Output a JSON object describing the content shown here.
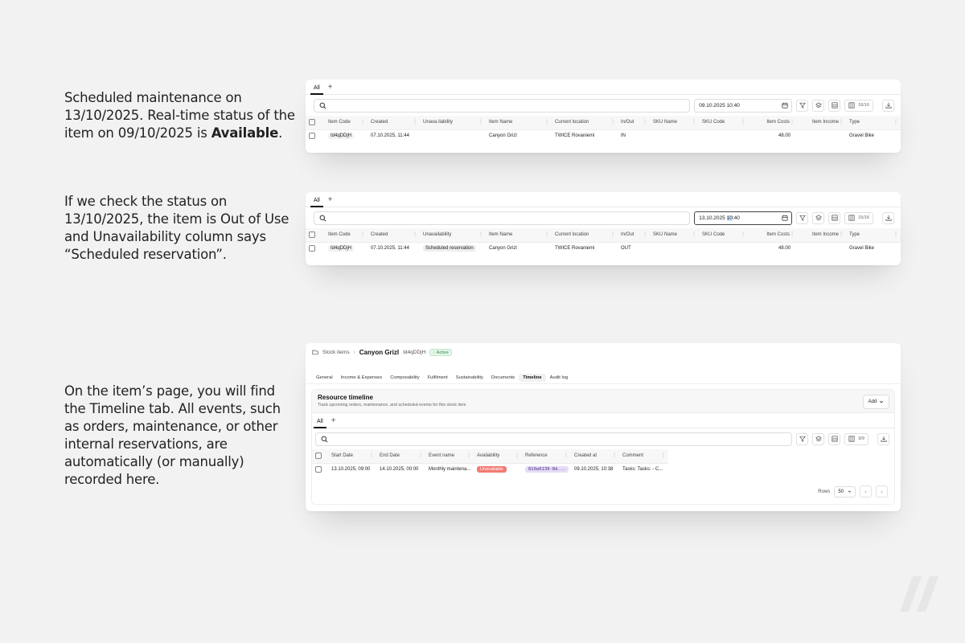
{
  "texts": {
    "desc1_a": "Scheduled maintenance on 13/10/2025. Real-time status of the item on 09/10/2025 is ",
    "desc1_b": "Available",
    "desc1_c": ".",
    "desc2": "If we check the status on 13/10/2025, the item is Out of Use and Unavailability column says “Scheduled reservation”.",
    "desc3": "On the item’s page, you will find the Timeline tab. All events, such as orders, maintenance, or other internal reservations, are automatically (or manually) recorded here."
  },
  "card1": {
    "tab_all": "All",
    "tab_add": "+",
    "date_value": "09.10.2025 10:40",
    "columns_count": "16/16",
    "headers": [
      "Item Code",
      "Created",
      "Unava ilability",
      "Item Name",
      "Current location",
      "In/Out",
      "SKU Name",
      "SKU Code",
      "Item Costs",
      "Item Income",
      "Type"
    ],
    "row": {
      "item_code": "Id4qDDjH",
      "created": "07.10.2025, 11:44",
      "unavailability": "",
      "item_name": "Canyon Grizl",
      "location": "TWICE Rovaniemi",
      "in_out": "IN",
      "sku_name": "",
      "sku_code": "",
      "costs": "48.00",
      "income": "",
      "type": "Gravel Bike"
    }
  },
  "card2": {
    "tab_all": "All",
    "tab_add": "+",
    "date_value_a": "13.10.2025 ",
    "date_value_sel": "10",
    "date_value_b": ":40",
    "columns_count": "15/16",
    "headers": [
      "Item Code",
      "Created",
      "Unavailability",
      "Item Name",
      "Current location",
      "In/Out",
      "SKU Name",
      "SKU Code",
      "Item Costs",
      "Item Income",
      "Type"
    ],
    "row": {
      "item_code": "Id4qDDjH",
      "created": "07.10.2025, 11:44",
      "unavailability": "Scheduled reservation",
      "item_name": "Canyon Grizl",
      "location": "TWICE Rovaniemi",
      "in_out": "OUT",
      "sku_name": "",
      "sku_code": "",
      "costs": "48.00",
      "income": "",
      "type": "Gravel Bike"
    }
  },
  "card3": {
    "breadcrumb": "Stock items",
    "title": "Canyon Grizl",
    "code": "Id4qDDjH",
    "badge": "Active",
    "tabs": [
      "General",
      "Income & Expenses",
      "Composability",
      "Fulfilment",
      "Sustainability",
      "Documents",
      "Timeline",
      "Audit log"
    ],
    "active_tab_index": 6,
    "panel_title": "Resource timeline",
    "panel_subtitle": "Track upcoming orders, maintenance, and scheduled events for this stock item",
    "add_label": "Add",
    "tab_all": "All",
    "tab_add": "+",
    "columns_count": "9/9",
    "headers": [
      "Start Date",
      "End Date",
      "Event name",
      "Availability",
      "Reference",
      "Created at",
      "Comment"
    ],
    "row": {
      "start": "13.10.2025, 09:00",
      "end": "14.10.2025, 00:00",
      "event": "Monthly maintena...",
      "availability": "Unavailable",
      "reference": "810a6139-8d...",
      "created_at": "09.10.2025, 10:38",
      "comment": "Tasks: Tasks: - C..."
    },
    "rows_label": "Rows",
    "rows_value": "50"
  },
  "icons": {
    "search": "search-icon",
    "calendar": "calendar-icon",
    "filter": "filter-icon",
    "layers": "layers-icon",
    "table": "table-icon",
    "columns": "columns-icon",
    "download": "download-icon",
    "folder": "folder-icon"
  },
  "colors": {
    "unavailable": "#f37a74",
    "reference_bg": "#e6dcf7",
    "active_badge": "#2f8a44"
  }
}
